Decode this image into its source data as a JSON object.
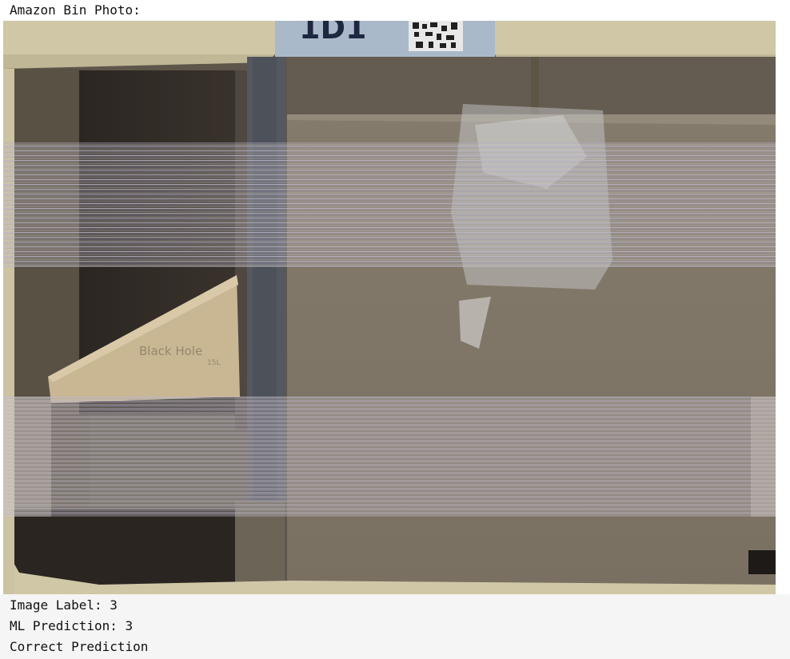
{
  "output": {
    "heading": "Amazon Bin Photo:",
    "label_line": "Image Label: 3",
    "prediction_line": "ML Prediction: 3",
    "verdict_line": "Correct Prediction"
  },
  "photo": {
    "bin_tag_text": "1D1",
    "box_print_line1": "Black Hole",
    "box_print_line2": "15L"
  }
}
